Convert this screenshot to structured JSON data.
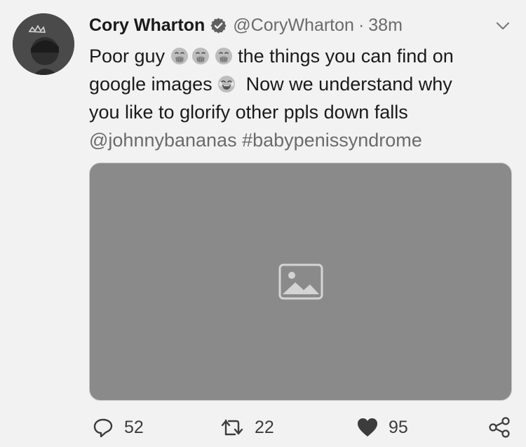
{
  "tweet": {
    "display_name": "Cory Wharton",
    "handle": "@CoryWharton",
    "separator": "·",
    "timestamp": "38m",
    "text": {
      "line1_a": "Poor guy",
      "line1_b": "the things you can find on",
      "line2_a": "google images",
      "line2_b": "Now we understand why",
      "line3": "you like to glorify other ppls down falls",
      "mention": "@johnnybananas",
      "hashtag": "#babypenissyndrome"
    },
    "emojis": [
      "face-with-hand-over-mouth-icon",
      "face-with-hand-over-mouth-icon",
      "face-with-hand-over-mouth-icon",
      "face-with-tears-of-joy-icon"
    ]
  },
  "actions": {
    "reply_count": "52",
    "retweet_count": "22",
    "like_count": "95"
  },
  "colors": {
    "background": "#f2f2f2",
    "text": "#1a1a1a",
    "muted": "#6b6b6b"
  }
}
